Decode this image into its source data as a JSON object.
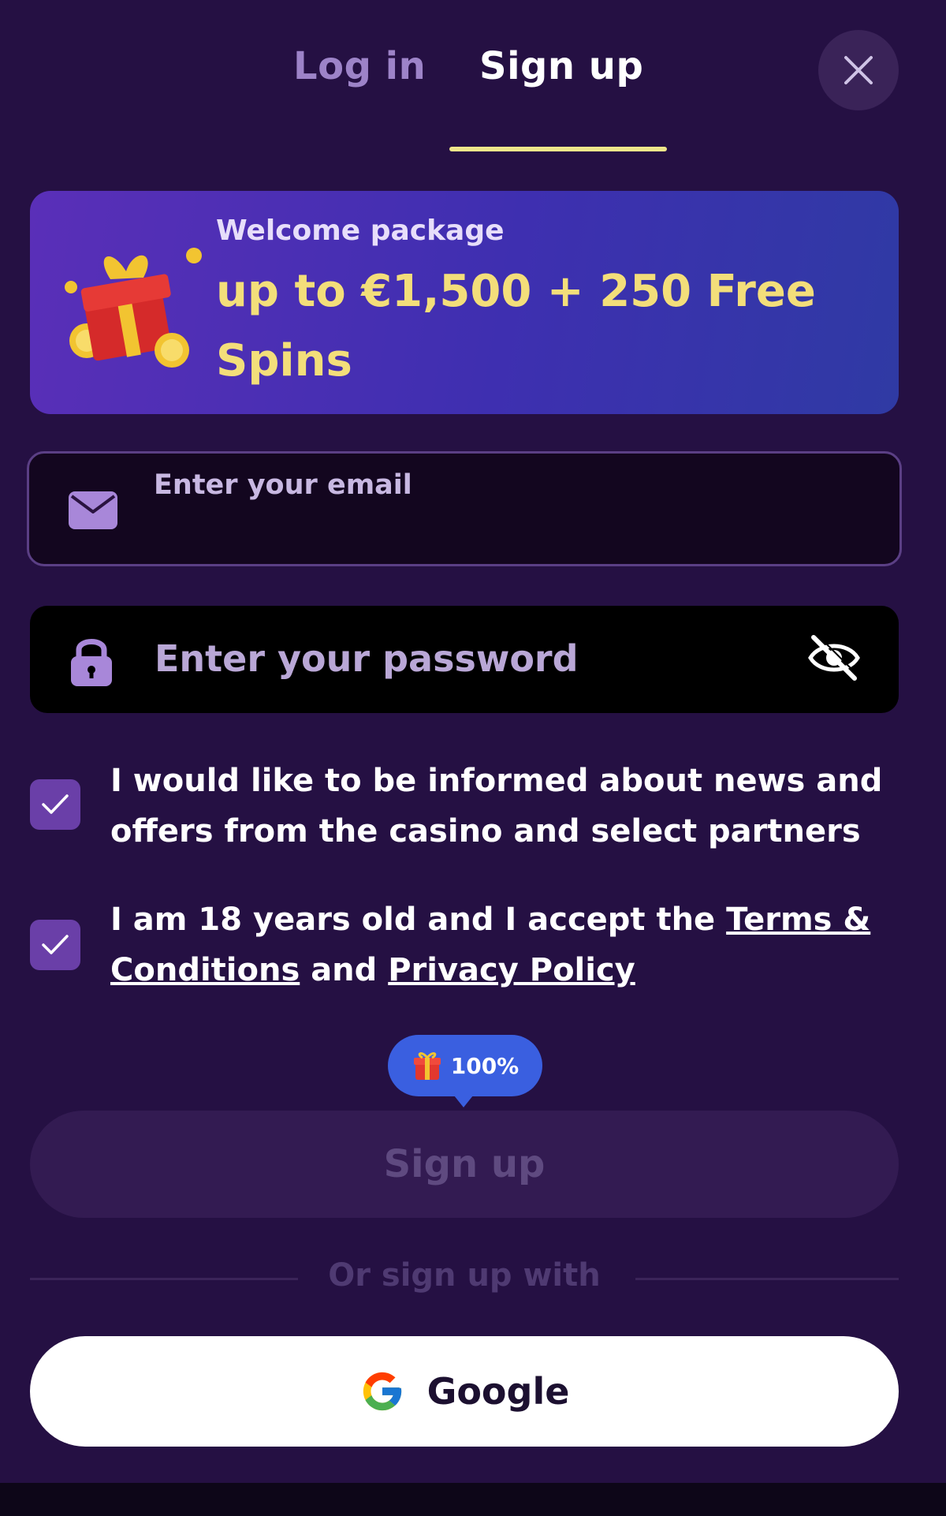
{
  "tabs": {
    "login_label": "Log in",
    "signup_label": "Sign up",
    "active": "signup"
  },
  "banner": {
    "kicker": "Welcome package",
    "offer": "up to €1,500 + 250 Free Spins"
  },
  "email": {
    "placeholder": "Enter your email"
  },
  "password": {
    "placeholder": "Enter your password"
  },
  "consents": {
    "news": {
      "checked": true,
      "text": "I would like to be informed about news and offers from the casino and select partners"
    },
    "age": {
      "checked": true,
      "prefix": "I am 18 years old and I accept the ",
      "terms_link": "Terms & Conditions",
      "middle": " and ",
      "privacy_link": "Privacy Policy"
    }
  },
  "bonus_bubble": {
    "text": "100%"
  },
  "submit": {
    "label": "Sign up"
  },
  "social": {
    "divider": "Or sign up with",
    "google_label": "Google"
  },
  "colors": {
    "background": "#251043",
    "accent_yellow": "#efe68a",
    "checkbox": "#6a3fa8",
    "bubble": "#3a5fe0"
  }
}
